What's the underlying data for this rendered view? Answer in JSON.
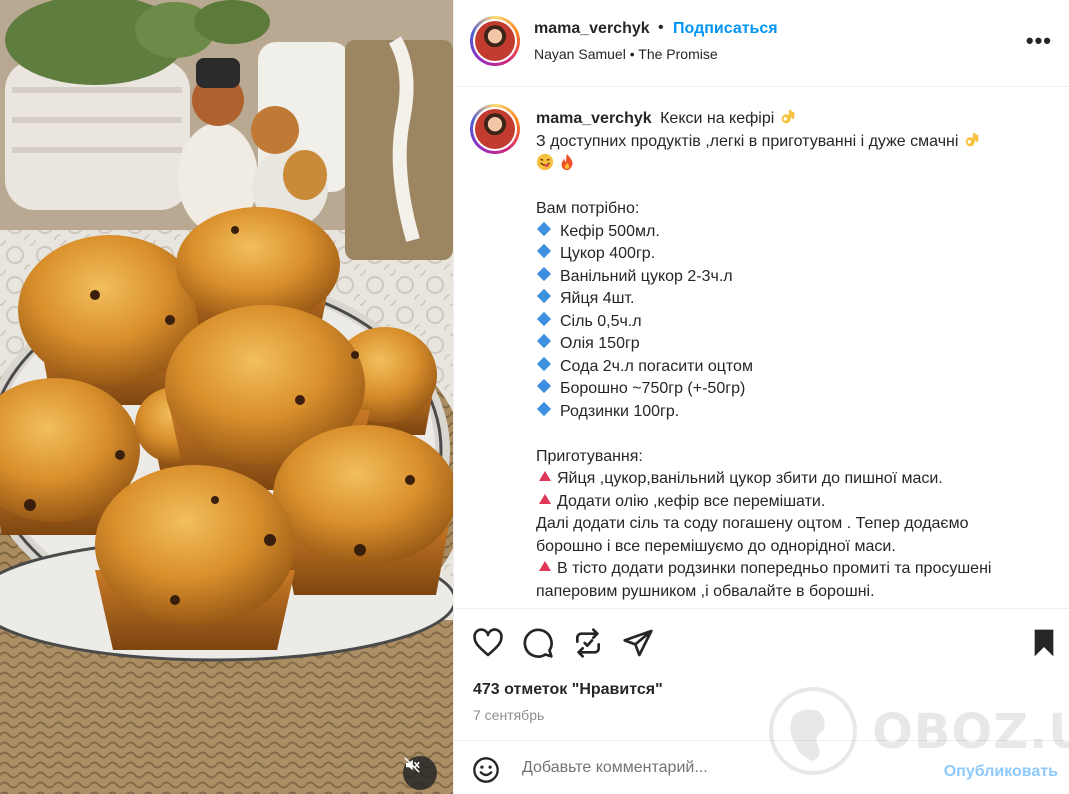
{
  "post": {
    "username": "mama_verchyk",
    "follow_label": "Подписаться",
    "separator": "•",
    "audio_artist": "Nayan Samuel",
    "audio_track": "The Promise",
    "more_label": "•••"
  },
  "caption": {
    "title": "Кекси на кефірі",
    "intro": "З доступних продуктів ,легкі в приготуванні і дуже смачні",
    "need_heading": "Вам потрібно:",
    "ingredients": [
      "Кефір 500мл.",
      "Цукор 400гр.",
      "Ванільний цукор 2-3ч.л",
      "Яйця 4шт.",
      "Сіль 0,5ч.л",
      "Олія 150гр",
      "Сода 2ч.л погасити оцтом",
      "Борошно ~750гр (+-50гр)",
      "Родзинки 100гр."
    ],
    "prep_heading": "Приготування:",
    "step1": "Яйця ,цукор,ванільний цукор збити до пишної маси.",
    "step2": "Додати олію ,кефір все перемішати.",
    "text1": "Далі додати сіль та соду погашену оцтом . Тепер додаємо",
    "text2": "борошно і все перемішуємо до однорідної маси.",
    "step3a": "В тісто додати родзинки попередньо промиті та просушені",
    "step3b": "паперовим рушником ,і обвалайте в борошні."
  },
  "stats": {
    "likes": "473 отметок \"Нравится\"",
    "date": "7 сентябрь"
  },
  "comment": {
    "placeholder": "Добавьте комментарий...",
    "post_label": "Опубликовать"
  },
  "watermark": "OBOZ.UA",
  "colors": {
    "accent_blue": "#0095f6",
    "post_disabled": "#8ec9fb",
    "diamond_blue": "#3d8fe0",
    "triangle_red": "#e0365a"
  },
  "icons": [
    "heart-icon",
    "comment-icon",
    "repost-icon",
    "share-icon",
    "bookmark-icon",
    "emoji-icon",
    "mute-icon",
    "more-icon"
  ]
}
